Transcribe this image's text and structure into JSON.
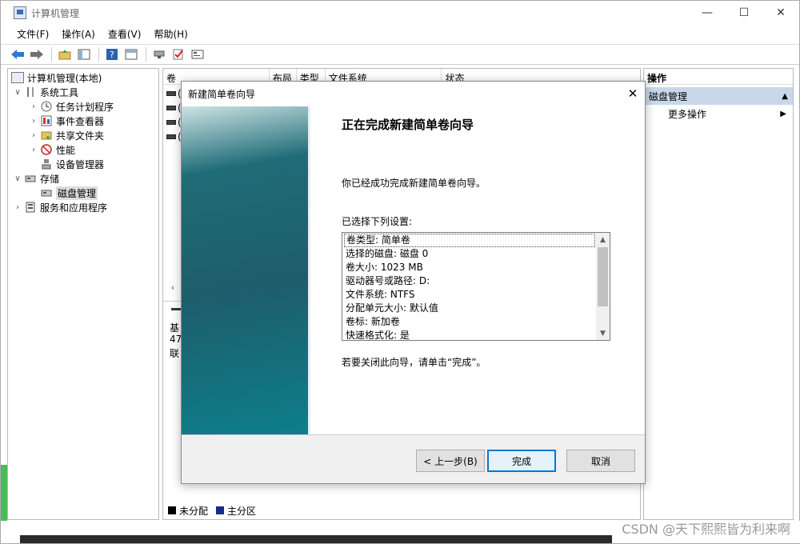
{
  "window": {
    "title": "计算机管理",
    "min_glyph": "—",
    "max_glyph": "☐",
    "close_glyph": "✕"
  },
  "menu": [
    "文件(F)",
    "操作(A)",
    "查看(V)",
    "帮助(H)"
  ],
  "toolbar": {
    "icons": [
      "back-icon",
      "forward-icon",
      "up-folder-icon",
      "show-tree-icon",
      "help-icon",
      "properties-icon",
      "connect-icon",
      "check-icon",
      "settings-icon"
    ]
  },
  "tree": {
    "root": "计算机管理(本地)",
    "system_tools": "系统工具",
    "task_scheduler": "任务计划程序",
    "event_viewer": "事件查看器",
    "shared_folders": "共享文件夹",
    "performance": "性能",
    "device_manager": "设备管理器",
    "storage": "存储",
    "disk_management": "磁盘管理",
    "services_apps": "服务和应用程序"
  },
  "volumes": {
    "columns": [
      "卷",
      "布局",
      "类型",
      "文件系统",
      "状态"
    ],
    "row_prefix": "(",
    "lower_lines": [
      "基",
      "47",
      "联"
    ]
  },
  "legend": {
    "unallocated": "未分配",
    "primary": "主分区"
  },
  "actions": {
    "header": "操作",
    "section": "磁盘管理",
    "more": "更多操作"
  },
  "dialog": {
    "title": "新建简单卷向导",
    "heading": "正在完成新建简单卷向导",
    "done_text": "你已经成功完成新建简单卷向导。",
    "selected_label": "已选择下列设置:",
    "settings": [
      "卷类型: 简单卷",
      "选择的磁盘: 磁盘 0",
      "卷大小: 1023 MB",
      "驱动器号或路径: D:",
      "文件系统: NTFS",
      "分配单元大小: 默认值",
      "卷标: 新加卷",
      "快速格式化: 是"
    ],
    "close_hint": "若要关闭此向导，请单击“完成”。",
    "back_button": "< 上一步(B)",
    "finish_button": "完成",
    "cancel_button": "取消"
  },
  "watermark": "CSDN @天下熙熙皆为利来啊"
}
